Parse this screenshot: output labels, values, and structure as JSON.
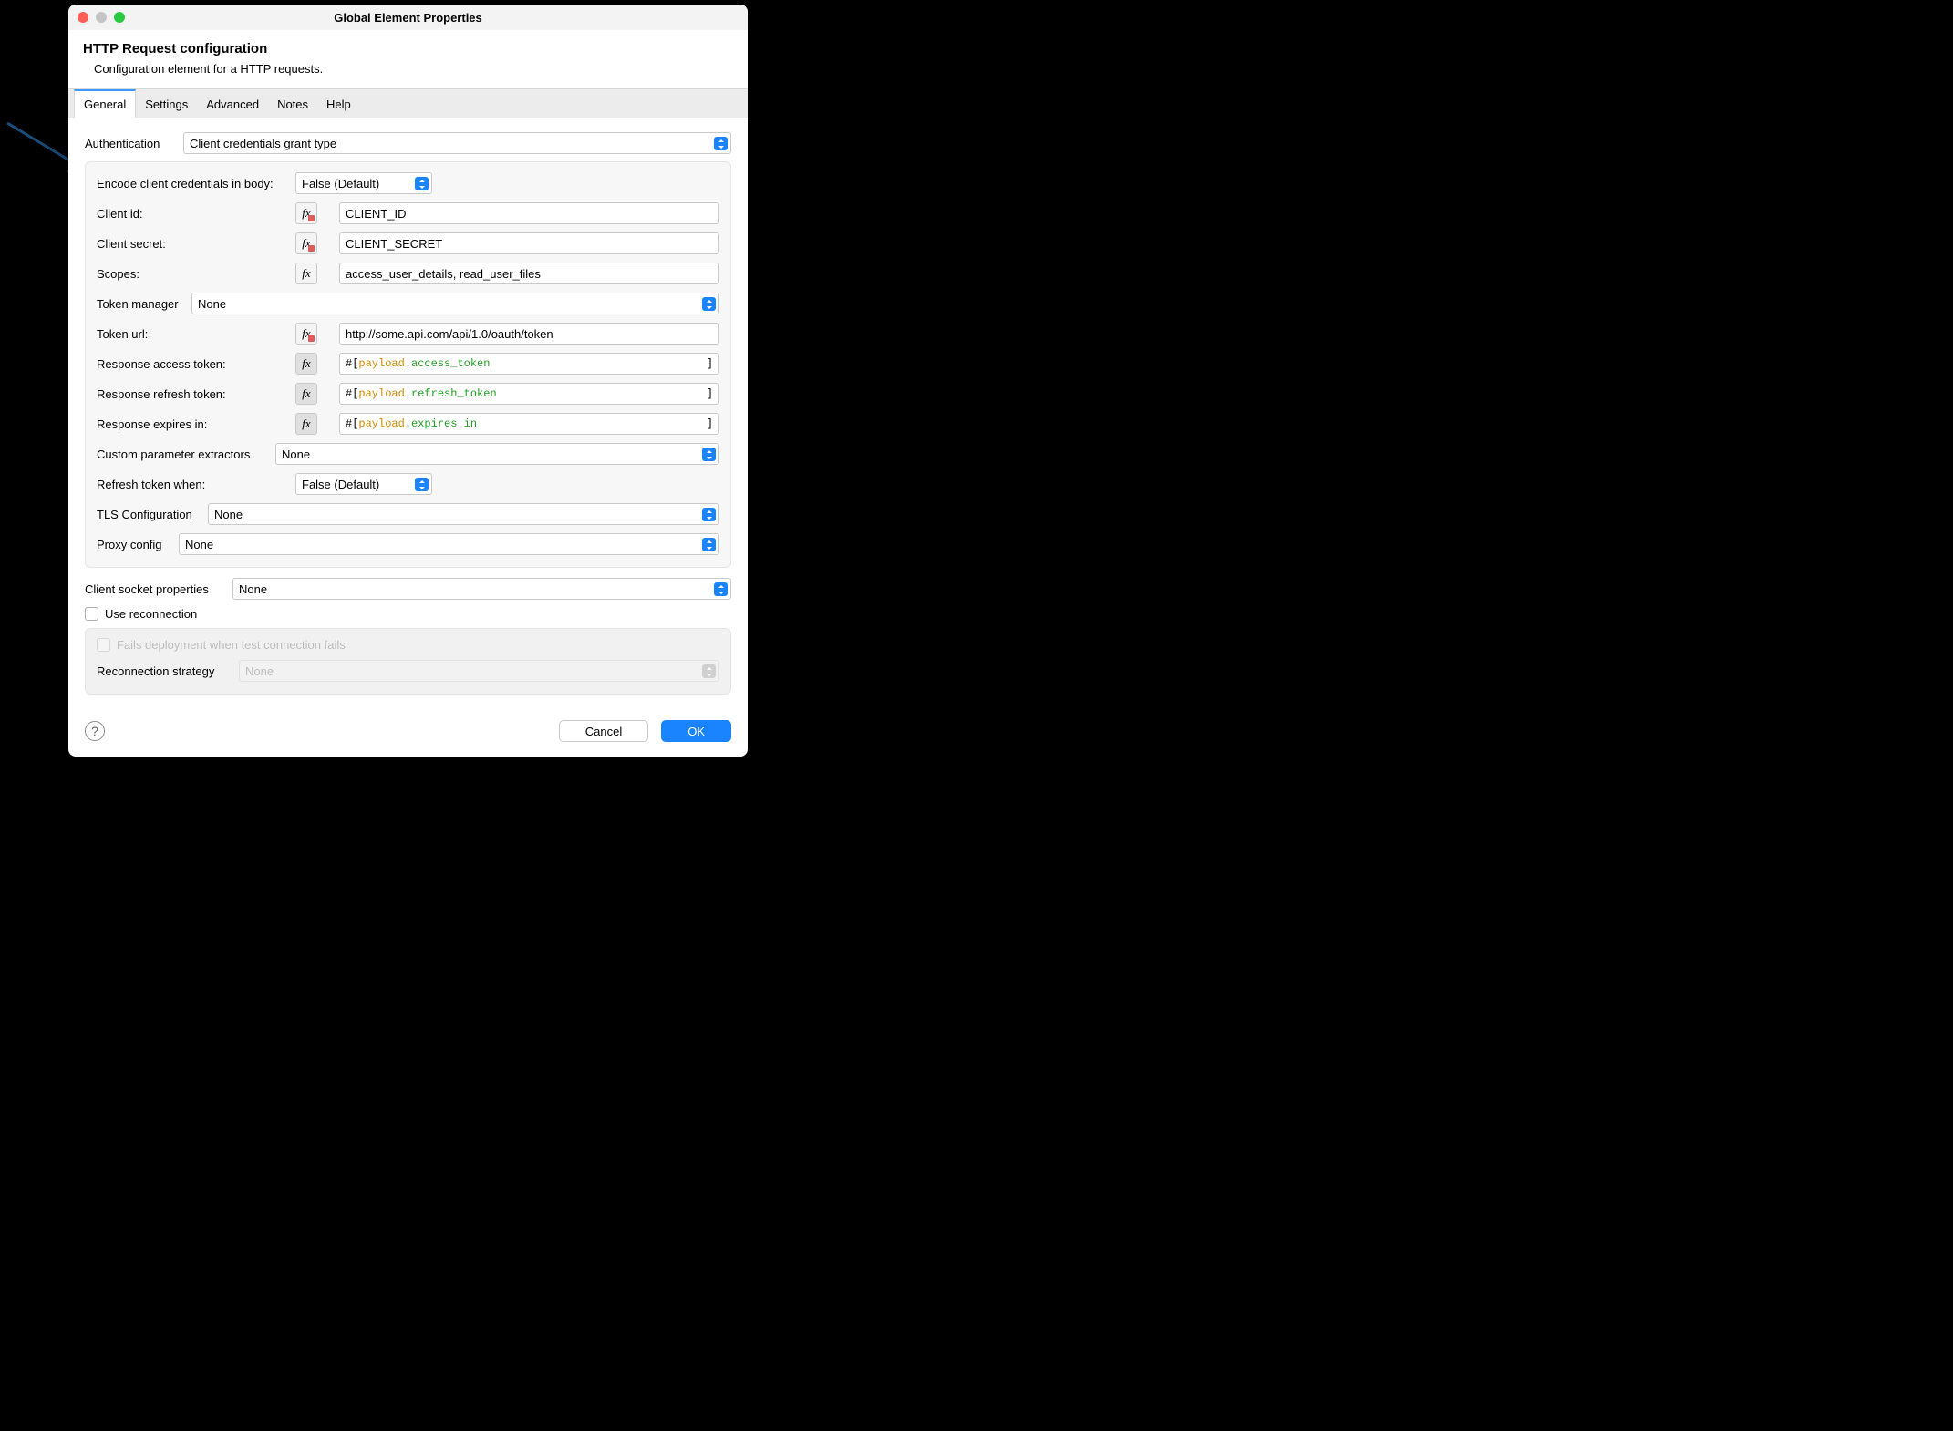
{
  "window": {
    "title": "Global Element Properties",
    "heading": "HTTP Request configuration",
    "subheading": "Configuration element for a HTTP requests."
  },
  "tabs": [
    "General",
    "Settings",
    "Advanced",
    "Notes",
    "Help"
  ],
  "activeTab": "General",
  "auth": {
    "label": "Authentication",
    "value": "Client credentials grant type"
  },
  "fields": {
    "encode": {
      "label": "Encode client credentials in body:",
      "value": "False (Default)"
    },
    "clientId": {
      "label": "Client id:",
      "value": "CLIENT_ID"
    },
    "clientSecret": {
      "label": "Client secret:",
      "value": "CLIENT_SECRET"
    },
    "scopes": {
      "label": "Scopes:",
      "value": "access_user_details, read_user_files"
    },
    "tokenManager": {
      "label": "Token manager",
      "value": "None"
    },
    "tokenUrl": {
      "label": "Token url:",
      "value": "http://some.api.com/api/1.0/oauth/token"
    },
    "respAccess": {
      "label": "Response access token:",
      "exprObj": "payload",
      "exprProp": "access_token"
    },
    "respRefresh": {
      "label": "Response refresh token:",
      "exprObj": "payload",
      "exprProp": "refresh_token"
    },
    "respExpires": {
      "label": "Response expires in:",
      "exprObj": "payload",
      "exprProp": "expires_in"
    },
    "customExtractors": {
      "label": "Custom parameter extractors",
      "value": "None"
    },
    "refreshWhen": {
      "label": "Refresh token when:",
      "value": "False (Default)"
    },
    "tls": {
      "label": "TLS Configuration",
      "value": "None"
    },
    "proxy": {
      "label": "Proxy config",
      "value": "None"
    },
    "socket": {
      "label": "Client socket properties",
      "value": "None"
    },
    "useReconnection": {
      "label": "Use reconnection"
    },
    "failsDeployment": {
      "label": "Fails deployment when test connection fails"
    },
    "reconnectionStrategy": {
      "label": "Reconnection strategy",
      "value": "None"
    }
  },
  "buttons": {
    "cancel": "Cancel",
    "ok": "OK"
  }
}
